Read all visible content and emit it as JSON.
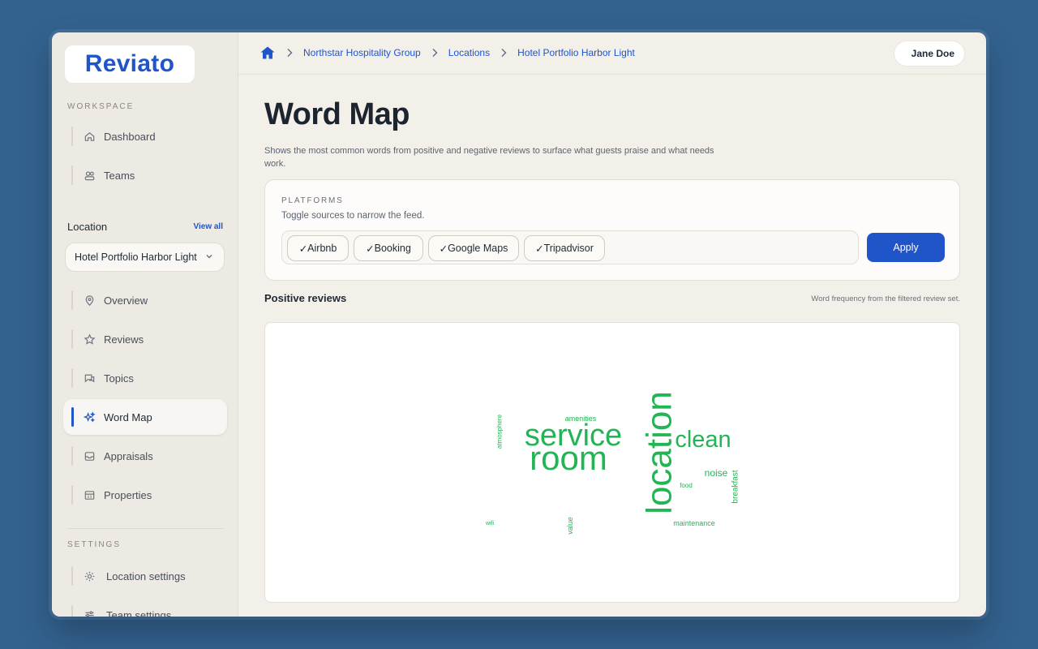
{
  "app": {
    "logo": "Reviato"
  },
  "sidebar": {
    "workspace_label": "WORKSPACE",
    "workspace_items": [
      {
        "label": "Dashboard",
        "icon": "home-icon"
      },
      {
        "label": "Teams",
        "icon": "users-icon"
      }
    ],
    "location_title": "Location",
    "view_all": "View all",
    "location_selected": "Hotel Portfolio Harbor Light",
    "location_items": [
      {
        "label": "Overview",
        "icon": "map-pin-icon"
      },
      {
        "label": "Reviews",
        "icon": "star-icon"
      },
      {
        "label": "Topics",
        "icon": "chat-icon"
      },
      {
        "label": "Word Map",
        "icon": "sparkles-icon",
        "active": true
      },
      {
        "label": "Appraisals",
        "icon": "inbox-icon"
      },
      {
        "label": "Properties",
        "icon": "building-icon"
      }
    ],
    "settings_label": "SETTINGS",
    "settings_items": [
      {
        "label": "Location settings",
        "icon": "gear-icon"
      },
      {
        "label": "Team settings",
        "icon": "sliders-icon"
      }
    ]
  },
  "breadcrumb": [
    "Northstar Hospitality Group",
    "Locations",
    "Hotel Portfolio Harbor Light"
  ],
  "user": {
    "name": "Jane Doe"
  },
  "page": {
    "title": "Word Map",
    "description": "Shows the most common words from positive and negative reviews to surface what guests praise and what needs work."
  },
  "platforms": {
    "label": "PLATFORMS",
    "hint": "Toggle sources to narrow the feed.",
    "chips": [
      "Airbnb",
      "Booking",
      "Google Maps",
      "Tripadvisor"
    ],
    "apply_label": "Apply"
  },
  "positive": {
    "title": "Positive reviews",
    "note": "Word frequency from the filtered review set."
  },
  "word_cloud": {
    "color": "#22b555",
    "words": [
      "service",
      "room",
      "location",
      "clean",
      "amenities",
      "atmosphere",
      "noise",
      "breakfast",
      "food",
      "wifi",
      "value",
      "maintenance"
    ]
  }
}
